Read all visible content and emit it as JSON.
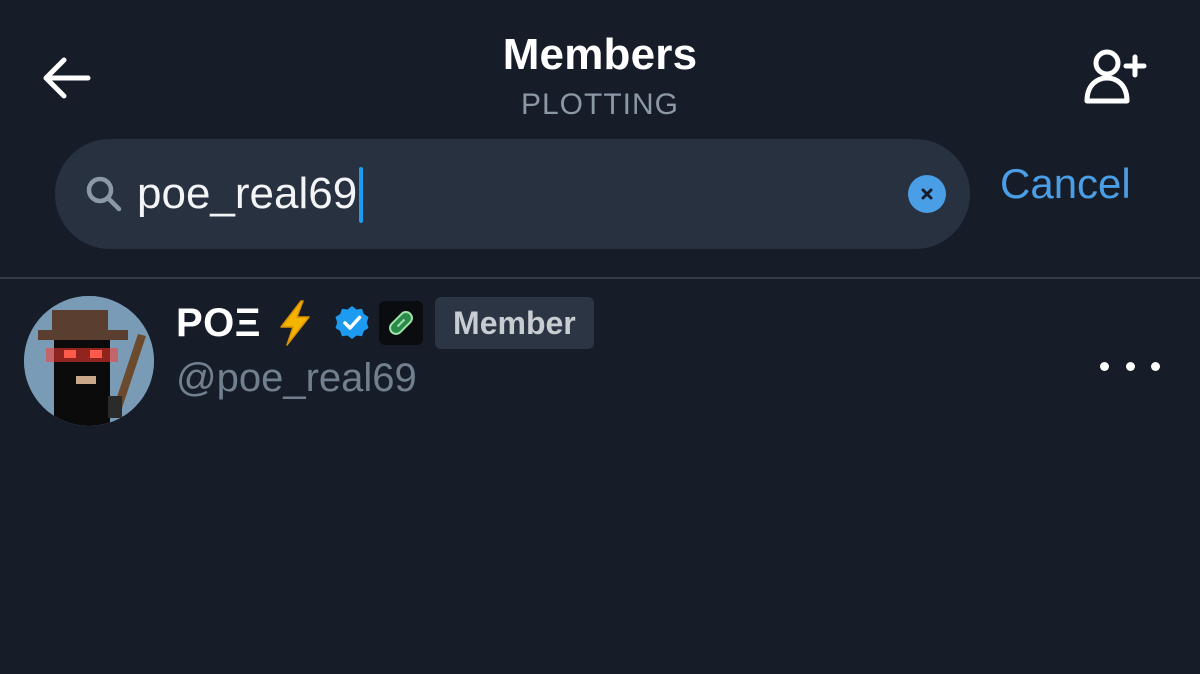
{
  "header": {
    "title": "Members",
    "subtitle": "PLOTTING"
  },
  "search": {
    "value": "poe_real69",
    "placeholder": "",
    "cancel_label": "Cancel"
  },
  "members": [
    {
      "display_name": "POΞ",
      "badge_emoji": "lightning-bolt",
      "verified": true,
      "role": "Member",
      "handle": "@poe_real69"
    }
  ],
  "colors": {
    "background": "#171d28",
    "accent": "#4a9ee6",
    "search_bg": "#283140",
    "muted_text": "#71808e"
  },
  "icons": {
    "back": "arrow-left-icon",
    "add_member": "add-user-icon",
    "search": "search-icon",
    "clear": "clear-icon",
    "verified": "verified-icon",
    "affiliate": "pill-icon",
    "more": "more-horizontal-icon"
  }
}
